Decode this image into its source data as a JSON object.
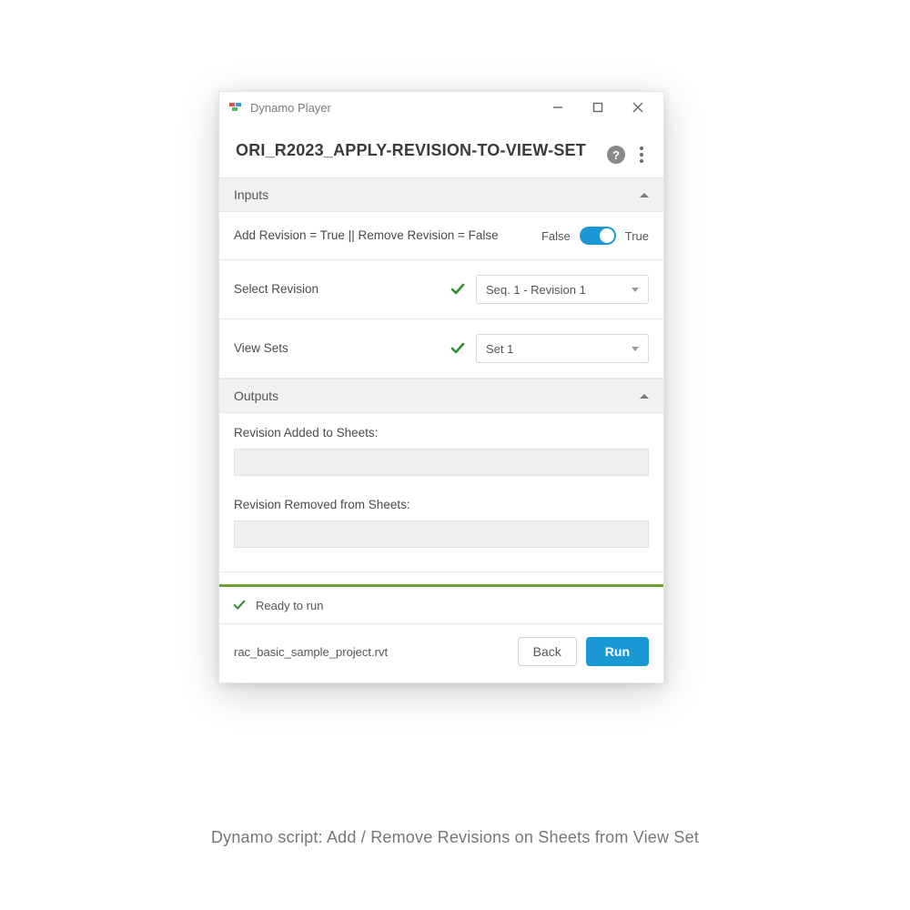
{
  "window": {
    "title": "Dynamo Player"
  },
  "header": {
    "script_name": "ORI_R2023_APPLY-REVISION-TO-VIEW-SET"
  },
  "sections": {
    "inputs_label": "Inputs",
    "outputs_label": "Outputs"
  },
  "inputs": {
    "toggle": {
      "label": "Add Revision = True || Remove Revision = False",
      "off_label": "False",
      "on_label": "True",
      "value": true
    },
    "revision": {
      "label": "Select Revision",
      "selected": "Seq. 1 - Revision 1",
      "valid": true
    },
    "viewset": {
      "label": "View Sets",
      "selected": "Set 1",
      "valid": true
    }
  },
  "outputs": {
    "added_label": "Revision Added to Sheets:",
    "added_value": "",
    "removed_label": "Revision Removed from Sheets:",
    "removed_value": ""
  },
  "status": {
    "text": "Ready to run"
  },
  "footer": {
    "project_file": "rac_basic_sample_project.rvt",
    "back_label": "Back",
    "run_label": "Run"
  },
  "caption": "Dynamo script: Add / Remove Revisions on Sheets from View Set"
}
